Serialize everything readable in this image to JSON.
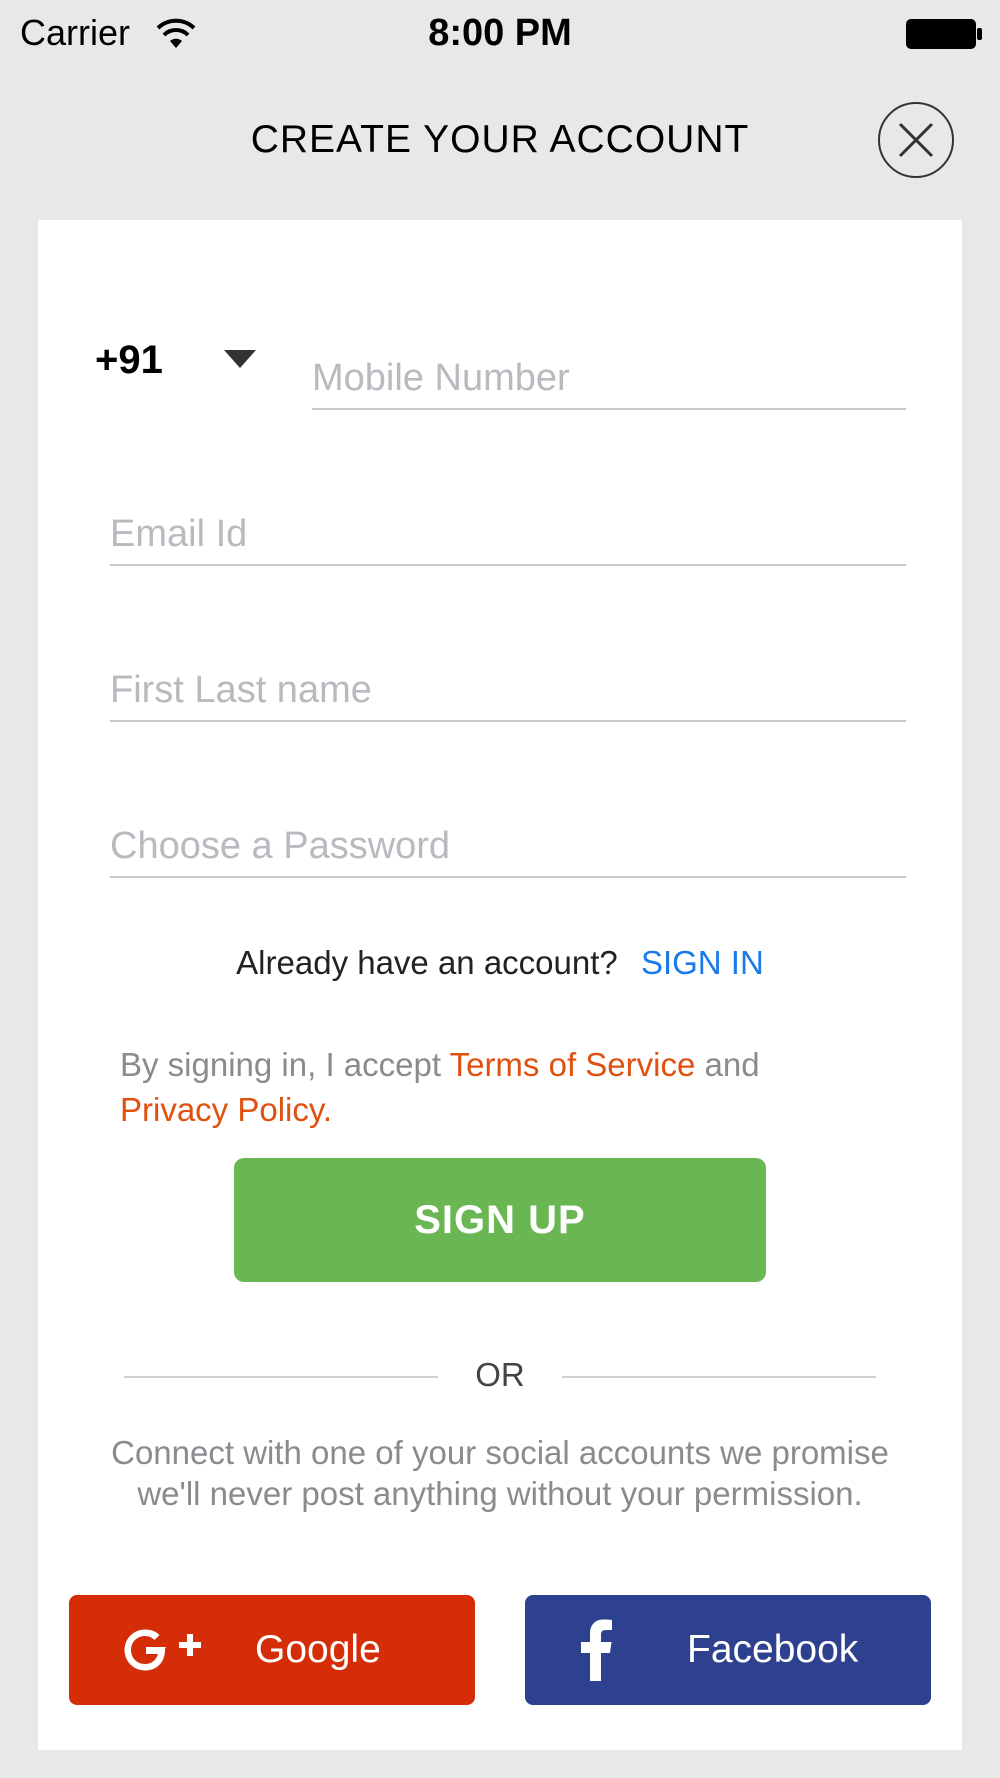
{
  "status_bar": {
    "carrier": "Carrier",
    "time": "8:00 PM",
    "wifi_icon": "wifi-icon",
    "battery_icon": "battery-icon"
  },
  "header": {
    "title": "CREATE YOUR ACCOUNT",
    "close_icon": "close-icon"
  },
  "form": {
    "country_code": "+91",
    "dropdown_icon": "caret-down-icon",
    "mobile_placeholder": "Mobile Number",
    "email_placeholder": "Email Id",
    "name_placeholder": "First Last name",
    "password_placeholder": "Choose a Password"
  },
  "signin": {
    "prompt": "Already have an account?",
    "link": "SIGN IN"
  },
  "terms": {
    "prefix": "By signing in, I accept ",
    "tos_link": "Terms of Service",
    "middle": " and",
    "privacy_link": "Privacy Policy."
  },
  "signup_button": "SIGN UP",
  "divider_text": "OR",
  "social": {
    "text": "Connect with one of your social accounts we promise we'll never post anything without your permission.",
    "google_label": "Google",
    "google_icon": "google-plus-icon",
    "facebook_label": "Facebook",
    "facebook_icon": "facebook-icon"
  },
  "colors": {
    "background": "#e8e8e8",
    "card": "#ffffff",
    "link_blue": "#1a7ae8",
    "link_orange": "#e0500f",
    "signup_green": "#69b652",
    "google_red": "#d42d08",
    "facebook_blue": "#2d418e"
  }
}
